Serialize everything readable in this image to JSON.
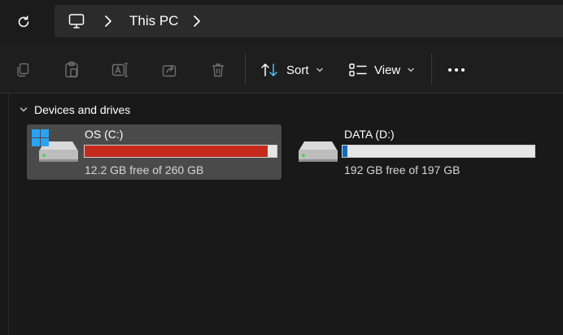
{
  "address": {
    "refresh_icon": "refresh-icon",
    "location_icon": "computer-icon",
    "crumbs": [
      "This PC"
    ]
  },
  "toolbar": {
    "icons": [
      "copy-icon",
      "paste-icon",
      "rename-icon",
      "share-icon",
      "delete-icon"
    ],
    "sort_label": "Sort",
    "view_label": "View",
    "more_label": "•••"
  },
  "content": {
    "group_title": "Devices and drives",
    "drives": [
      {
        "name": "OS (C:)",
        "free_text": "12.2 GB free of 260 GB",
        "used_fraction": 0.953,
        "bar_color": "#c42b1c",
        "is_system": true,
        "selected": true
      },
      {
        "name": "DATA (D:)",
        "free_text": "192 GB free of 197 GB",
        "used_fraction": 0.025,
        "bar_color": "#0f6cbd",
        "is_system": false,
        "selected": false
      }
    ]
  },
  "colors": {
    "background": "#191919",
    "selected_tile": "#4a4a4a",
    "windows_logo": "#2aa3f5"
  }
}
